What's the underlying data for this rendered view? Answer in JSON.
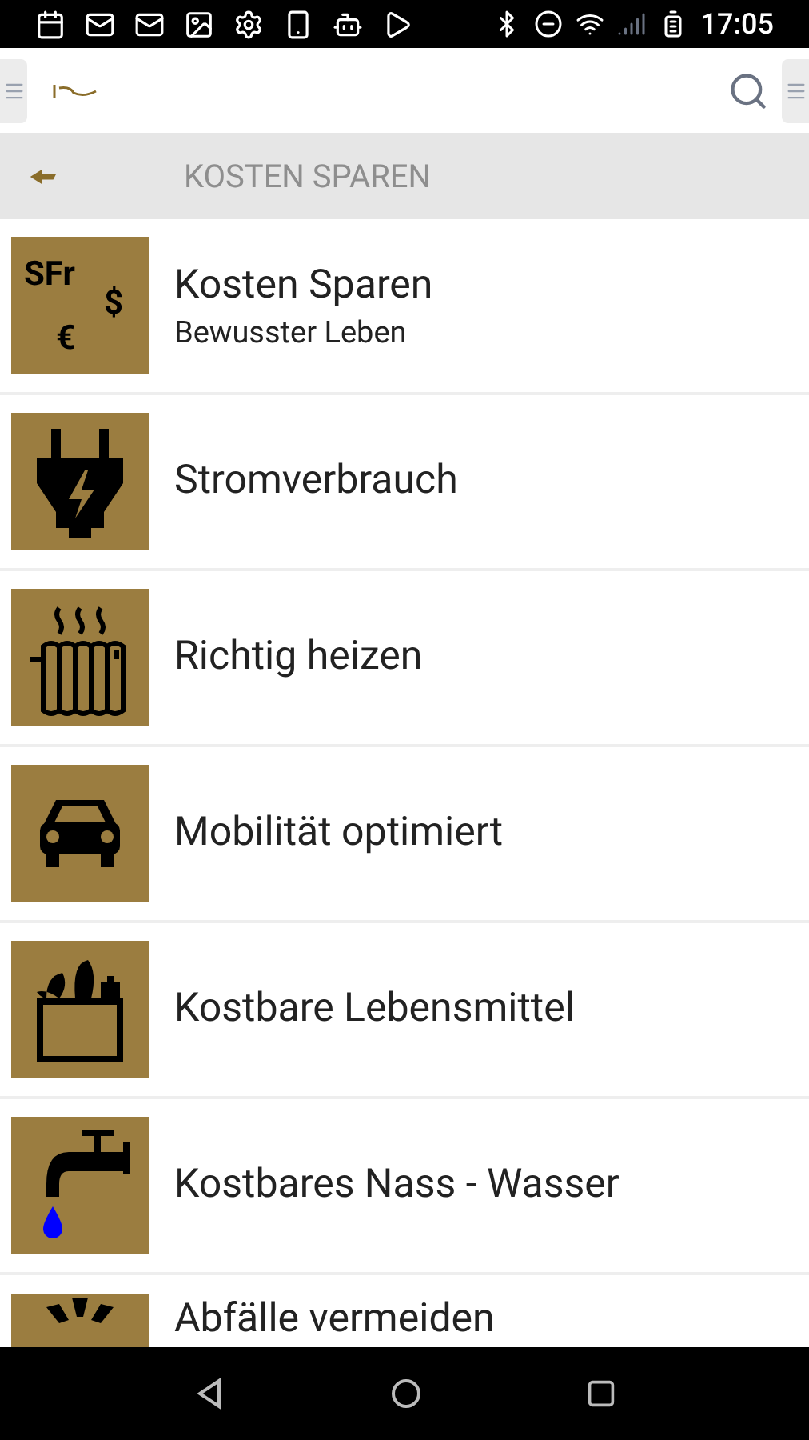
{
  "status_bar": {
    "time": "17:05"
  },
  "header": {
    "title": "KOSTEN SPAREN"
  },
  "items": [
    {
      "icon_text": [
        "SFr",
        "$",
        "€"
      ],
      "title": "Kosten Sparen",
      "subtitle": "Bewusster Leben"
    },
    {
      "title": "Stromverbrauch"
    },
    {
      "title": "Richtig heizen"
    },
    {
      "title": "Mobilität optimiert"
    },
    {
      "title": "Kostbare Lebensmittel"
    },
    {
      "title": "Kostbares Nass - Wasser"
    },
    {
      "title": "Abfälle vermeiden"
    }
  ]
}
